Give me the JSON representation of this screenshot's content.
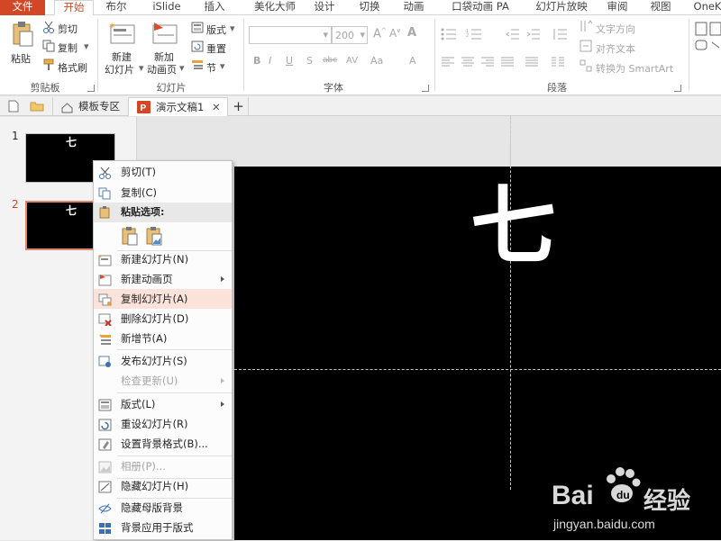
{
  "ribbon_tabs": [
    "文件",
    "开始",
    "布尔",
    "iSlide",
    "插入",
    "美化大师",
    "设计",
    "切换",
    "动画",
    "口袋动画 PA",
    "幻灯片放映",
    "审阅",
    "视图",
    "OneK"
  ],
  "clipboard": {
    "paste": "粘贴",
    "cut": "剪切",
    "copy": "复制",
    "format_painter": "格式刷",
    "group": "剪贴板"
  },
  "slides_group": {
    "new_slide": [
      "新建",
      "幻灯片"
    ],
    "new_anim": [
      "新加",
      "动画页"
    ],
    "layout": "版式",
    "reset": "重置",
    "section": "节",
    "group": "幻灯片"
  },
  "font_group": {
    "size": "200",
    "group": "字体"
  },
  "paragraph_group": {
    "text_dir": "文字方向",
    "align_text": "对齐文本",
    "smartart": "转换为 SmartArt",
    "group": "段落"
  },
  "doc_tabs": {
    "template": "模板专区",
    "doc": "演示文稿1",
    "close": "✕",
    "add": "+"
  },
  "slide_numbers": [
    "1",
    "2"
  ],
  "slide_glyph": "七",
  "context_menu": {
    "cut": "剪切(T)",
    "copy": "复制(C)",
    "paste_options": "粘贴选项:",
    "new_slide": "新建幻灯片(N)",
    "new_anim_page": "新建动画页",
    "duplicate": "复制幻灯片(A)",
    "delete": "删除幻灯片(D)",
    "new_section": "新增节(A)",
    "publish": "发布幻灯片(S)",
    "check_updates": "检查更新(U)",
    "layout": "版式(L)",
    "reset": "重设幻灯片(R)",
    "bg_format": "设置背景格式(B)...",
    "album": "相册(P)...",
    "hide_slide": "隐藏幻灯片(H)",
    "hide_master_bg": "隐藏母版背景",
    "apply_bg_layout": "背景应用于版式"
  },
  "watermark": {
    "brand": "Bai",
    "brand2": "经验",
    "url": "jingyan.baidu.com"
  },
  "colors": {
    "accent": "#d24726",
    "highlight": "#fbe3db"
  }
}
